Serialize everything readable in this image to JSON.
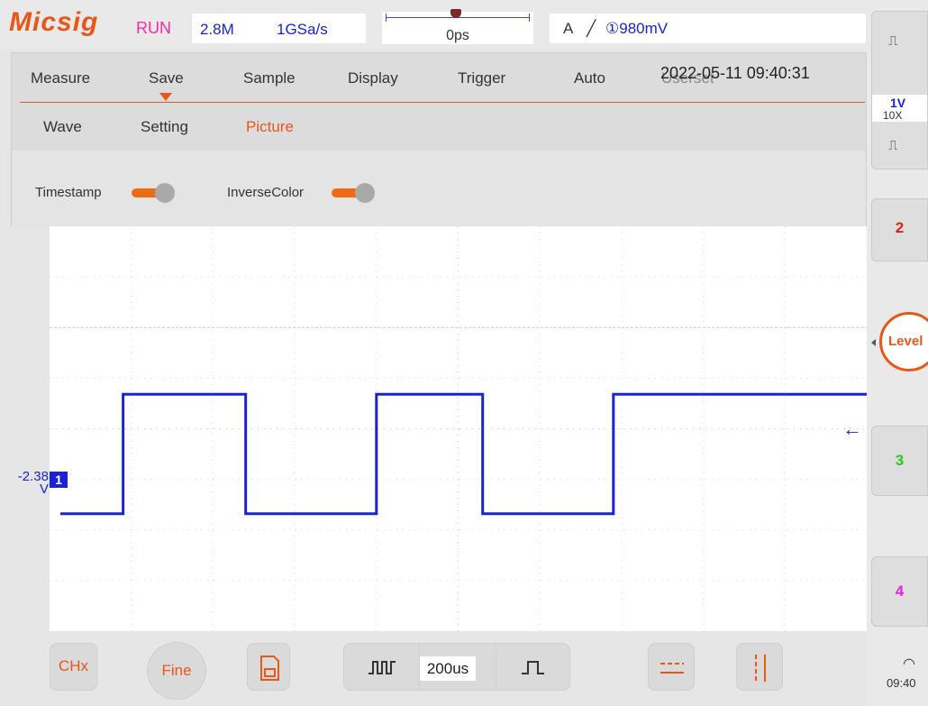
{
  "topbar": {
    "logo": "Micsig",
    "run_state": "RUN",
    "memory_depth": "2.8M",
    "sample_rate": "1GSa/s",
    "trigger_time": "0ps",
    "trigger_mode": "A",
    "trigger_edge_symbol": "╱",
    "trigger_level": "①980mV"
  },
  "menu": {
    "tabs": [
      "Measure",
      "Save",
      "Sample",
      "Display",
      "Trigger",
      "Auto",
      "Userset"
    ],
    "active_tab": "Save",
    "datetime": "2022-05-11 09:40:31",
    "subtabs": [
      "Wave",
      "Setting",
      "Picture"
    ],
    "active_subtab": "Picture",
    "options": [
      {
        "label": "Timestamp",
        "on": true
      },
      {
        "label": "InverseColor",
        "on": true
      }
    ]
  },
  "waveform": {
    "channel_label": "1",
    "offset_value": "-2.38",
    "offset_unit": "V",
    "color": "#1a22d6",
    "high_level_div": 1.0,
    "low_level_div": -1.0,
    "edges_div": [
      0.9,
      2.4,
      4.0,
      5.3,
      6.9
    ]
  },
  "right_panel": {
    "ch1": {
      "scale": "1V",
      "probe": "10X",
      "pulse_icon": "⎍"
    },
    "ch2": {
      "label": "2",
      "color": "#e0201a"
    },
    "level_button": "Level",
    "ch3": {
      "label": "3",
      "color": "#22cc22"
    },
    "ch4": {
      "label": "4",
      "color": "#ee22ee"
    }
  },
  "bottom": {
    "chx_button": "CHx",
    "fine_button": "Fine",
    "save_icon": "save-icon",
    "timebase": "200us",
    "cursor_h_icon": "cursor-horizontal-icon",
    "cursor_v_icon": "cursor-vertical-icon"
  },
  "status": {
    "clock": "09:40"
  },
  "accent": "#e8571a"
}
